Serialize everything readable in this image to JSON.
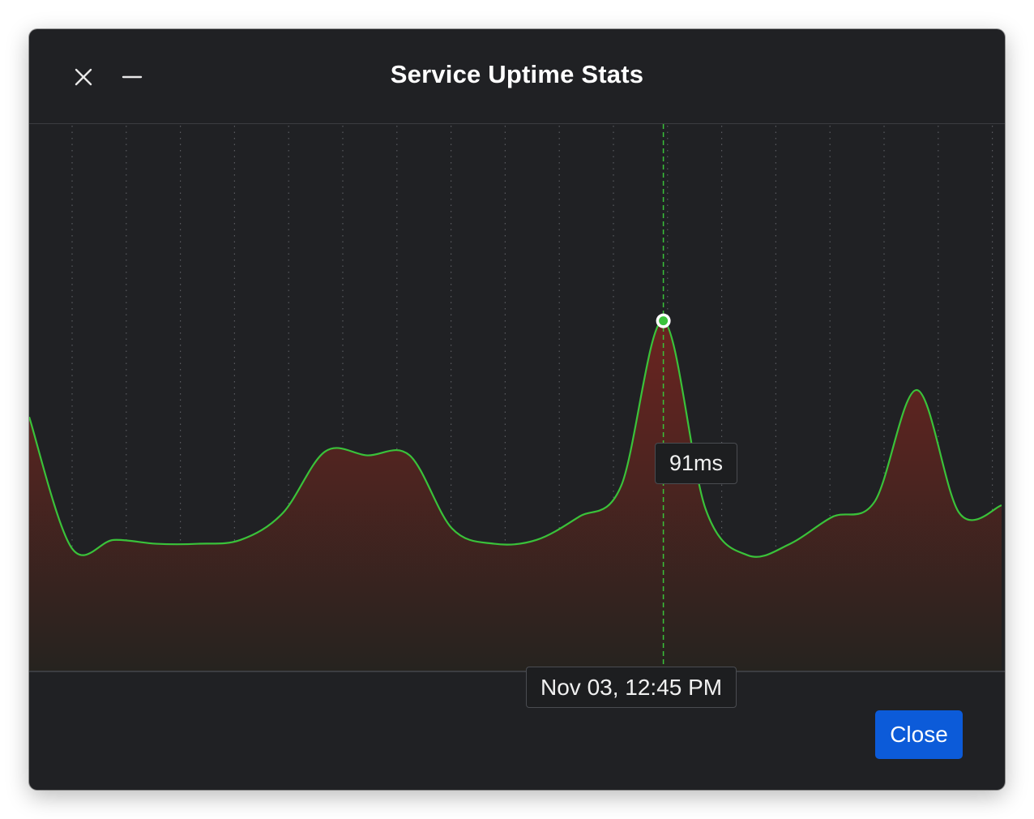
{
  "window": {
    "title": "Service Uptime Stats",
    "close_icon": "close-icon",
    "minimize_icon": "minimize-icon"
  },
  "colors": {
    "background": "#202124",
    "line": "#3ac23a",
    "fill_top": "#6b2420",
    "fill_bottom": "#26231f",
    "accent": "#0c5bd9",
    "crosshair": "#3ac23a"
  },
  "chart_data": {
    "type": "area",
    "y_unit": "ms",
    "series": [
      {
        "values": [
          66,
          32,
          34,
          33,
          33,
          34,
          41,
          57,
          56,
          56,
          37,
          33,
          34,
          40,
          48,
          91,
          42,
          30,
          33,
          40,
          44,
          73,
          41,
          43
        ]
      }
    ],
    "highlight": {
      "index": 15,
      "value_label": "91ms",
      "x_label": "Nov 03, 12:45 PM"
    },
    "grid": "vertical-dotted",
    "legend": "none"
  },
  "footer": {
    "close_label": "Close"
  }
}
